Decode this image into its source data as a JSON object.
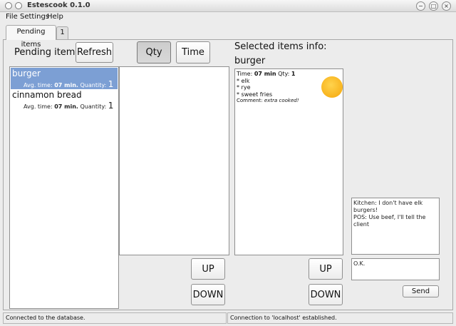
{
  "window": {
    "title": "Estescook 0.1.0"
  },
  "menu": [
    "File",
    "Settings",
    "Help"
  ],
  "tabs": [
    "Pending items",
    "1"
  ],
  "pending": {
    "label": "Pending items:",
    "refresh_label": "Refresh",
    "items": [
      {
        "name": "burger",
        "avg_label": "Avg. time:",
        "avg_value": "07 min.",
        "qty_label": "Quantity:",
        "qty_value": "1"
      },
      {
        "name": "cinnamon bread",
        "avg_label": "Avg. time:",
        "avg_value": "07 min.",
        "qty_label": "Quantity:",
        "qty_value": "1"
      }
    ]
  },
  "sort": {
    "qty_label": "Qty",
    "time_label": "Time"
  },
  "middle": {
    "up_label": "UP",
    "down_label": "DOWN"
  },
  "selected": {
    "label": "Selected items info:",
    "name": "burger",
    "time_label": "Time:",
    "time_value": "07 min",
    "qty_label": "Qty:",
    "qty_value": "1",
    "ingredients": [
      "* elk",
      "* rye",
      "* sweet fries"
    ],
    "comment_label": "Comment:",
    "comment_value": "extra cooked!",
    "up_label": "UP",
    "down_label": "DOWN"
  },
  "chat": {
    "messages": [
      "Kitchen: I don't have elk burgers!",
      "POS: Use beef, I'll tell the client"
    ],
    "input_value": "O.K.",
    "send_label": "Send"
  },
  "status": {
    "left": "Connected to the database.",
    "right": "Connection to 'localhost' established."
  }
}
